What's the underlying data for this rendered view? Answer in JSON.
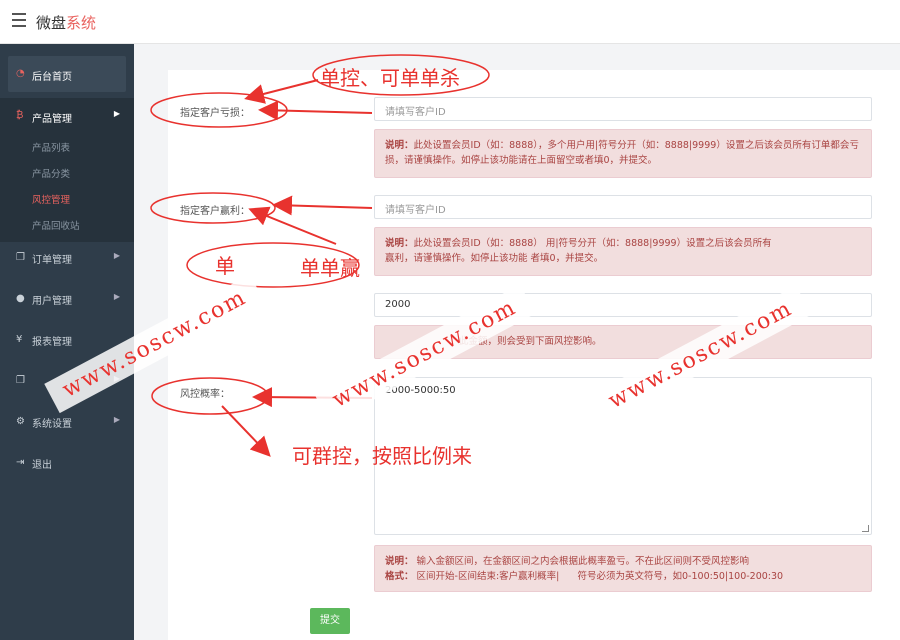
{
  "header": {
    "brand_main": "微盘",
    "brand_accent": "系统"
  },
  "sidebar": {
    "home": "后台首页",
    "product": "产品管理",
    "product_sub": [
      "产品列表",
      "产品分类",
      "风控管理",
      "产品回收站"
    ],
    "orders": "订单管理",
    "users": "用户管理",
    "reports": "报表管理",
    "settings": "系统设置",
    "logout": "退出"
  },
  "form": {
    "loss_label": "指定客户亏损：",
    "loss_placeholder": "请填写客户ID",
    "loss_note_title": "说明：",
    "loss_note": "此处设置会员ID（如：8888），多个用户用|符号分开（如：8888|9999）设置之后该会员所有订单都会亏损，请谨慎操作。如停止该功能请在上面留空或者填0，并提交。",
    "win_label": "指定客户赢利：",
    "win_placeholder": "请填写客户ID",
    "win_note_title": "说明：",
    "win_note_a": "此处设置会员ID（如：8888）",
    "win_note_b": "用|符号分开（如：8888|9999）设置之后该会员所有",
    "win_note_c": "赢利，请谨慎操作。如停止该功能",
    "win_note_d": "者填0，并提交。",
    "amount_value": "2000",
    "amount_note": "此金额，则会受到下面风控影响。",
    "rate_label": "风控概率：",
    "rate_value": "2000-5000:50",
    "rate_note_title": "说明：",
    "rate_note": "输入金额区间，在金额区间之内会根据此概率盈亏。不在此区间则不受风控影响",
    "format_title": "格式：",
    "format_note_a": "区间开始-区间结束:客户赢利概率|",
    "format_note_b": "符号必须为英文符号，如0-100:50|100-200:30",
    "submit": "提交"
  },
  "annotations": {
    "single_control": "单控、可单单杀",
    "single_win_a": "单",
    "single_win_b": "单单赢",
    "group_control": "可群控，按照比例来",
    "watermark": "www.soscw.com"
  },
  "colors": {
    "accent": "#e9635f",
    "sidebar": "#2f3d4a",
    "note_bg": "#f2dede",
    "submit": "#5cb85c",
    "annotation": "#e8322e"
  }
}
